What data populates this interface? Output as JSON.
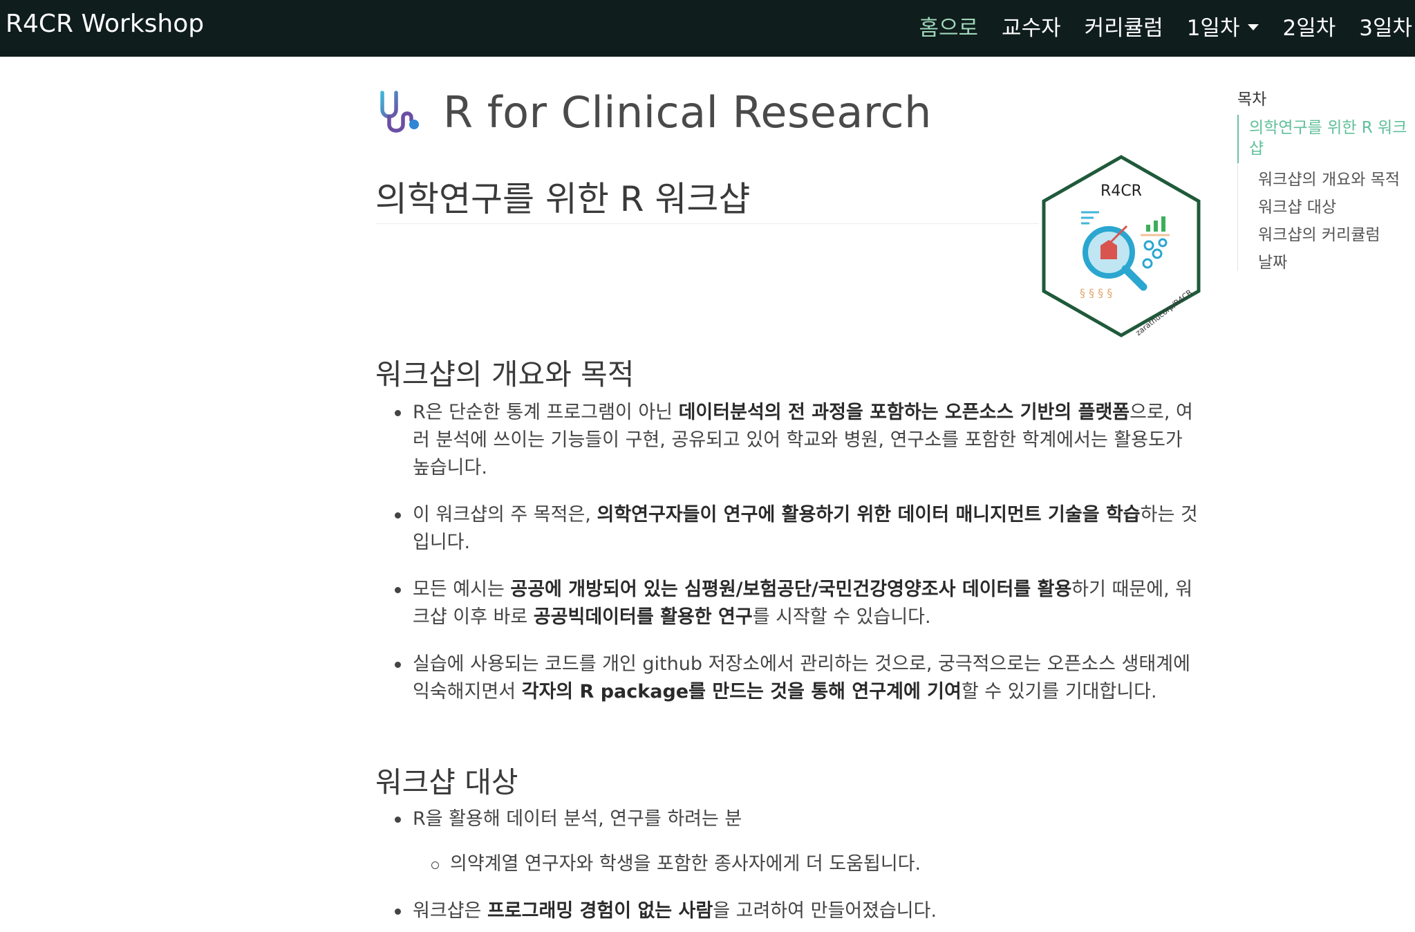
{
  "navbar": {
    "brand": "R4CR Workshop",
    "items": [
      {
        "label": "홈으로",
        "active": true
      },
      {
        "label": "교수자",
        "active": false
      },
      {
        "label": "커리큘럼",
        "active": false
      },
      {
        "label": "1일차",
        "active": false,
        "dropdown": true
      },
      {
        "label": "2일차",
        "active": false
      },
      {
        "label": "3일차",
        "active": false
      }
    ],
    "bg_color": "#0f1d1c",
    "active_color": "#9fd6ba"
  },
  "title": {
    "icon": "stethoscope-icon",
    "text": "R for Clinical Research"
  },
  "hero": {
    "heading": "의학연구를 위한 R 워크샵",
    "logo_label": "R4CR",
    "logo_caption": "zarathucorp/R4CR",
    "logo_border_color": "#1f5a3a"
  },
  "section1": {
    "heading": "워크샵의 개요와 목적",
    "items": [
      {
        "t1": "R은 단순한 통계 프로그램이 아닌 ",
        "b1": "데이터분석의 전 과정을 포함하는 오픈소스 기반의 플랫폼",
        "t2": "으로, 여러 분석에 쓰이는 기능들이 구현, 공유되고 있어 학교와 병원, 연구소를 포함한 학계에서는 활용도가 높습니다.",
        "b2": "",
        "t3": ""
      },
      {
        "t1": "이 워크샵의 주 목적은, ",
        "b1": "의학연구자들이 연구에 활용하기 위한 데이터 매니지먼트 기술을 학습",
        "t2": "하는 것입니다.",
        "b2": "",
        "t3": ""
      },
      {
        "t1": "모든 예시는 ",
        "b1": "공공에 개방되어 있는 심평원/보험공단/국민건강영양조사 데이터를 활용",
        "t2": "하기 때문에, 워크샵 이후 바로 ",
        "b2": "공공빅데이터를 활용한 연구",
        "t3": "를 시작할 수 있습니다."
      },
      {
        "t1": "실습에 사용되는 코드를 개인 github 저장소에서 관리하는 것으로, 궁극적으로는 오픈소스 생태계에 익숙해지면서 ",
        "b1": "각자의 R package를 만드는 것을 통해 연구계에 기여",
        "t2": "할 수 있기를 기대합니다.",
        "b2": "",
        "t3": ""
      }
    ]
  },
  "section2": {
    "heading": "워크샵 대상",
    "item1": "R을 활용해 데이터 분석, 연구를 하려는 분",
    "subitem": "의약계열 연구자와 학생을 포함한 종사자에게 더 도움됩니다.",
    "item2_t1": "워크샵은 ",
    "item2_b1": "프로그래밍 경험이 없는 사람",
    "item2_t2": "을 고려하여 만들어졌습니다."
  },
  "toc": {
    "title": "목차",
    "active": "의학연구를 위한 R 워크샵",
    "items": [
      "워크샵의 개요와 목적",
      "워크샵 대상",
      "워크샵의 커리큘럼",
      "날짜"
    ],
    "active_color": "#5fbf9a"
  }
}
